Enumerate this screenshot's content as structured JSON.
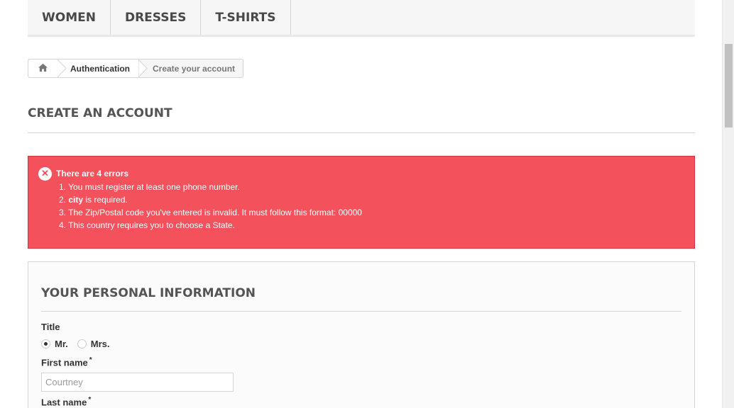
{
  "topmenu": {
    "items": [
      "WOMEN",
      "DRESSES",
      "T-SHIRTS"
    ]
  },
  "breadcrumb": {
    "home_icon": "home-icon",
    "items": [
      "Authentication",
      "Create your account"
    ]
  },
  "page": {
    "heading": "CREATE AN ACCOUNT"
  },
  "alert": {
    "icon": "close-circle-icon",
    "title": "There are 4 errors",
    "errors": [
      {
        "num": "1.",
        "bold": "",
        "text": " You must register at least one phone number."
      },
      {
        "num": "2.",
        "bold": "city",
        "text": " is required."
      },
      {
        "num": "3.",
        "bold": "",
        "text": " The Zip/Postal code you've entered is invalid. It must follow this format: 00000"
      },
      {
        "num": "4.",
        "bold": "",
        "text": " This country requires you to choose a State."
      }
    ],
    "bg_color": "#f3515c"
  },
  "form": {
    "section_title": "YOUR PERSONAL INFORMATION",
    "title_label": "Title",
    "title_options": [
      "Mr.",
      "Mrs."
    ],
    "title_selected": "Mr.",
    "first_name_label": "First name",
    "first_name_value": "Courtney",
    "last_name_label": "Last name",
    "required_mark": "*"
  }
}
